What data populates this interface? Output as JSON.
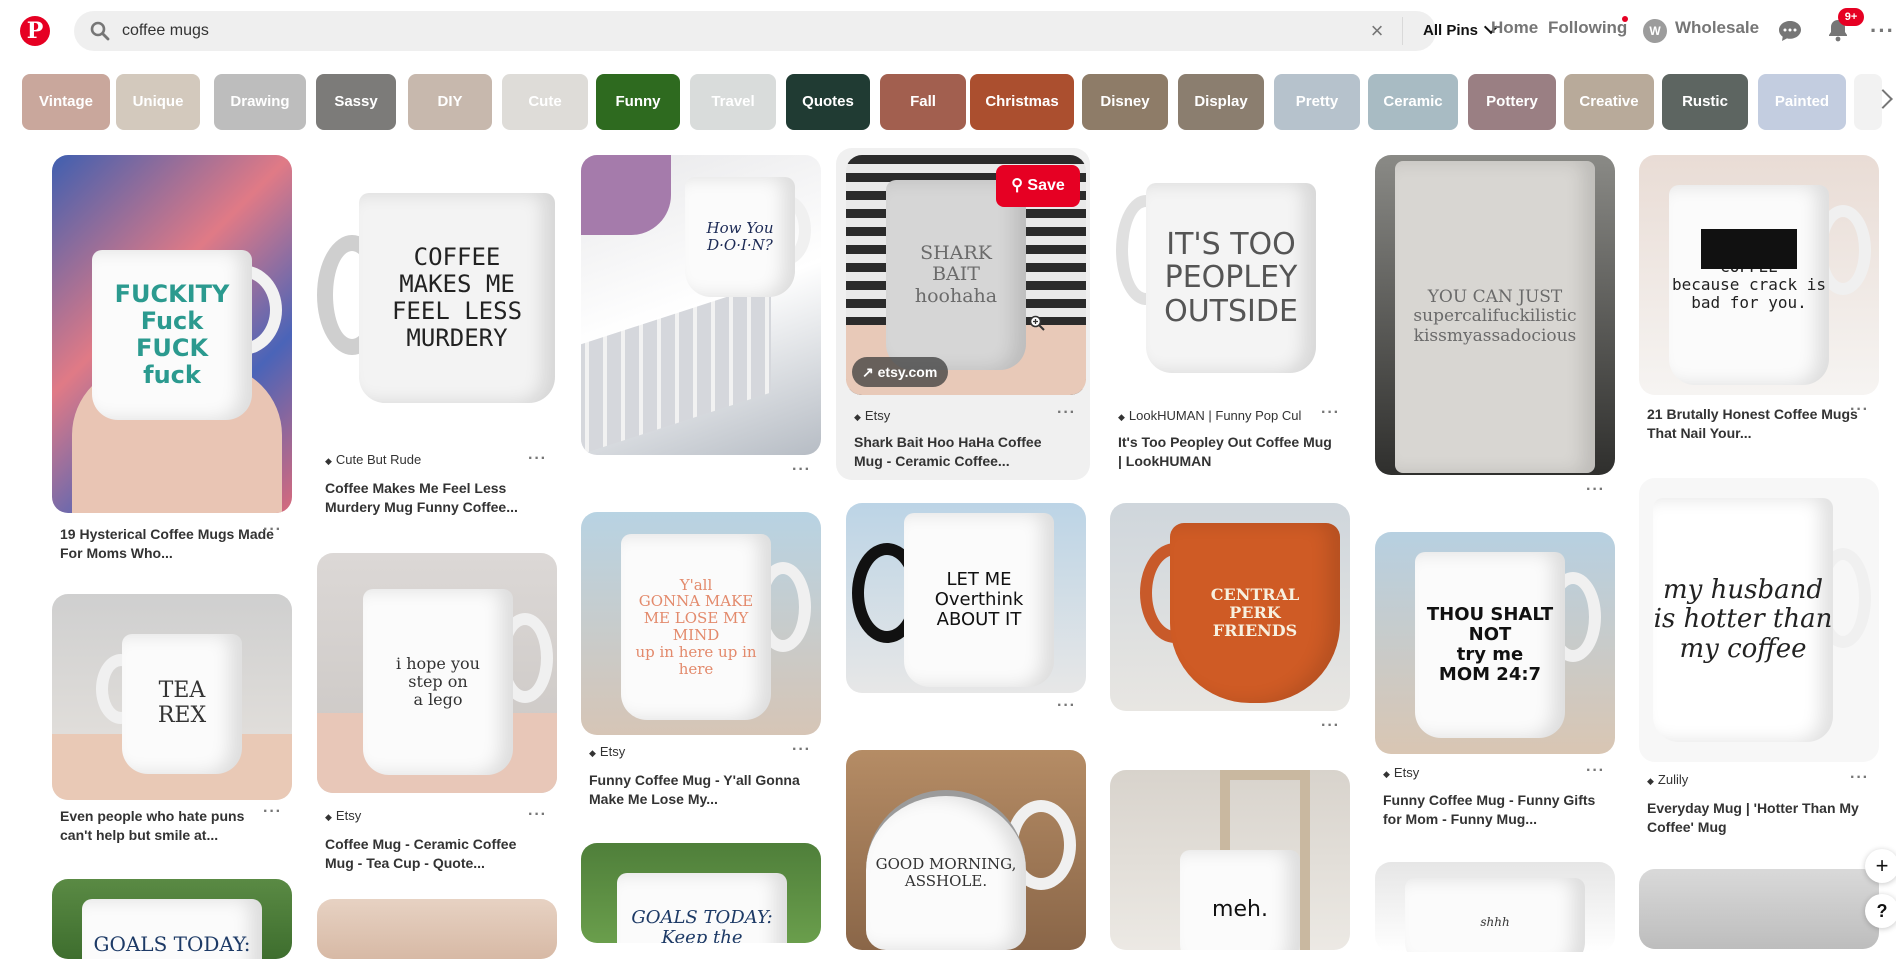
{
  "header": {
    "logo": "P",
    "search": {
      "value": "coffee mugs",
      "placeholder": "Search"
    },
    "filter": "All Pins",
    "nav": [
      "Home",
      "Following",
      "Wholesale"
    ],
    "avatar_initial": "W",
    "notif_badge": "9+",
    "more": "···"
  },
  "guides": [
    {
      "label": "Vintage",
      "color": "#c9a79c"
    },
    {
      "label": "Unique",
      "color": "#d3c9bd"
    },
    {
      "label": "Drawing",
      "color": "#bdbdbd"
    },
    {
      "label": "Sassy",
      "color": "#7c7b79"
    },
    {
      "label": "DIY",
      "color": "#c7b8ad"
    },
    {
      "label": "Cute",
      "color": "#dedcd8"
    },
    {
      "label": "Funny",
      "color": "#2e6a1f"
    },
    {
      "label": "Travel",
      "color": "#d9dcdb"
    },
    {
      "label": "Quotes",
      "color": "#203b33"
    },
    {
      "label": "Fall",
      "color": "#a25f4f"
    },
    {
      "label": "Christmas",
      "color": "#ab4f2f"
    },
    {
      "label": "Disney",
      "color": "#8e7c68"
    },
    {
      "label": "Display",
      "color": "#8b7e6f"
    },
    {
      "label": "Pretty",
      "color": "#b6c2cc"
    },
    {
      "label": "Ceramic",
      "color": "#a8bbc3"
    },
    {
      "label": "Pottery",
      "color": "#9a7f83"
    },
    {
      "label": "Creative",
      "color": "#b8aa9a"
    },
    {
      "label": "Rustic",
      "color": "#5d6561"
    },
    {
      "label": "Painted",
      "color": "#c3cde0"
    }
  ],
  "pins": [
    {
      "mug_text": "FUCKITY\nFuck\nFUCK\nfuck",
      "title": "19 Hysterical Coffee Mugs Made For Moms Who..."
    },
    {
      "mug_text": "TEA\nREX",
      "title": "Even people who hate puns can't help but smile at..."
    },
    {
      "mug_text": "GOALS TODAY:"
    },
    {
      "mug_text": "COFFEE\nMAKES ME\nFEEL LESS\nMURDERY",
      "source": "Cute But Rude",
      "title": "Coffee Makes Me Feel Less Murdery Mug Funny Coffee..."
    },
    {
      "mug_text": "i hope you\nstep on\na lego",
      "source": "Etsy",
      "title": "Coffee Mug - Ceramic Coffee Mug - Tea Cup - Quote..."
    },
    {
      "mug_text": "How You\nD·O·I·N?"
    },
    {
      "mug_text": "Y'all\nGONNA MAKE\nME LOSE MY MIND\nup in here up in here",
      "source": "Etsy",
      "title": "Funny Coffee Mug - Y'all Gonna Make Me Lose My..."
    },
    {
      "mug_text": "GOALS TODAY:\nKeep the"
    },
    {
      "mug_text": "SHARK\nBAIT\nhoohaha",
      "source": "Etsy",
      "title": "Shark Bait Hoo HaHa Coffee Mug - Ceramic Coffee...",
      "save": "Save",
      "link": "etsy.com"
    },
    {
      "mug_text": "LET ME\nOverthink\nABOUT IT"
    },
    {
      "mug_text": "GOOD MORNING,\nASSHOLE."
    },
    {
      "mug_text": "IT'S TOO\nPEOPLEY\nOUTSIDE",
      "source": "LookHUMAN | Funny Pop Cul",
      "title": "It's Too Peopley Out Coffee Mug | LookHUMAN"
    },
    {
      "mug_text": "CENTRAL\nPERK\nFRIENDS"
    },
    {
      "mug_text": "meh."
    },
    {
      "mug_text": "YOU CAN JUST\nsupercalifuckilistic\nkissmyassadocious"
    },
    {
      "mug_text": "THOU SHALT\nNOT\ntry me\nMOM 24:7",
      "source": "Etsy",
      "title": "Funny Coffee Mug - Funny Gifts for Mom - Funny Mug..."
    },
    {
      "mug_text": "shhh"
    },
    {
      "mug_text": "COFFEE\nbecause crack is\nbad for you.",
      "title": "21 Brutally Honest Coffee Mugs That Nail Your..."
    },
    {
      "mug_text": "my husband\nis hotter than\nmy coffee",
      "source": "Zulily",
      "title": "Everyday Mug | 'Hotter Than My Coffee' Mug"
    },
    {
      "mug_text": ""
    }
  ],
  "float": {
    "add": "+",
    "help": "?"
  }
}
